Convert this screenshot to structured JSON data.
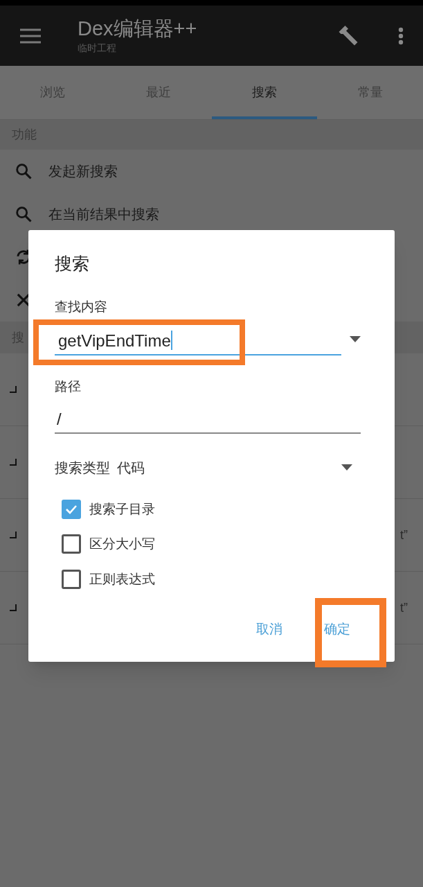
{
  "app_bar": {
    "title": "Dex编辑器++",
    "subtitle": "临时工程"
  },
  "tabs": [
    {
      "label": "浏览",
      "selected": false
    },
    {
      "label": "最近",
      "selected": false
    },
    {
      "label": "搜索",
      "selected": true
    },
    {
      "label": "常量",
      "selected": false
    }
  ],
  "functions": {
    "header": "功能",
    "items": [
      {
        "kind": "search",
        "label": "发起新搜索"
      },
      {
        "kind": "search",
        "label": "在当前结果中搜索"
      },
      {
        "kind": "refresh"
      },
      {
        "kind": "close"
      }
    ]
  },
  "results": {
    "header": "搜",
    "rows": [
      {},
      {},
      {
        "tail": "t”"
      },
      {
        "tail": "t”"
      }
    ]
  },
  "dialog": {
    "title": "搜索",
    "find_label": "查找内容",
    "find_value": "getVipEndTime",
    "path_label": "路径",
    "path_value": "/",
    "type_label": "搜索类型",
    "type_value": "代码",
    "options": [
      {
        "label": "搜索子目录",
        "checked": true
      },
      {
        "label": "区分大小写",
        "checked": false
      },
      {
        "label": "正则表达式",
        "checked": false
      }
    ],
    "buttons": [
      "取消",
      "确定"
    ]
  }
}
